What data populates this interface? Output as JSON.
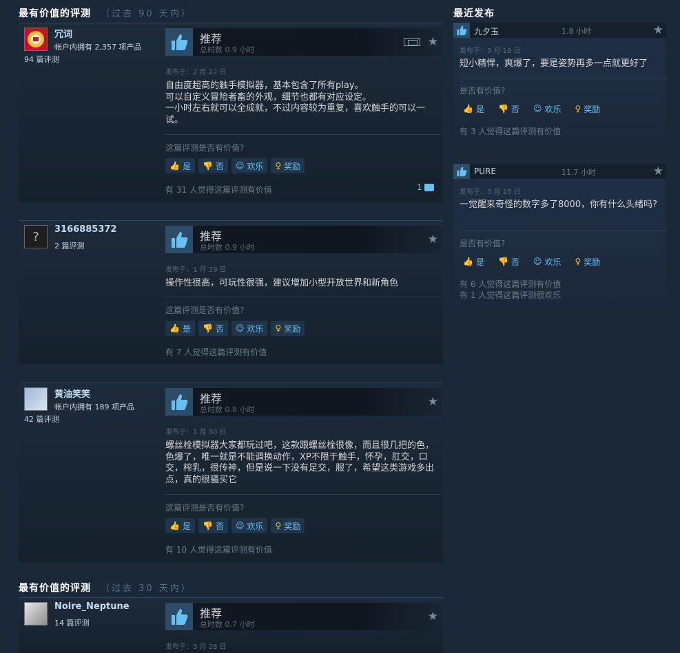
{
  "sections": {
    "most_helpful_90": {
      "title": "最有价值的评测",
      "period": "（过去 90 天内）"
    },
    "recent": {
      "title": "最近发布"
    },
    "most_helpful_30": {
      "title": "最有价值的评测",
      "period": "（过去 30 天内）"
    }
  },
  "labels": {
    "recommended": "推荐",
    "helpful_question": "这篇评测是否有价值?",
    "helpful_question_short": "是否有价值?",
    "yes": "是",
    "no": "否",
    "funny": "欢乐",
    "award": "奖励"
  },
  "reviews": [
    {
      "user": "冗词",
      "products": "帐户内拥有 2,357 项产品",
      "review_count": "94 篇评测",
      "hours": "总时数 0.9 小时",
      "posted": "发布于：2 月 22 日",
      "content": "自由度超高的触手模拟器，基本包含了所有play。\n可以自定义冒险者畜的外观，细节也都有对应设定。\n一小时左右就可以全成就，不过内容较为重复，喜欢触手的可以一试。",
      "helpful": "有 31 人觉得这篇评测有价值",
      "comments": "1"
    },
    {
      "user": "3166885372",
      "products": "",
      "review_count": "2 篇评测",
      "hours": "总时数 0.9 小时",
      "posted": "发布于：1 月 29 日",
      "content": "操作性很高，可玩性很强，建议增加小型开放世界和新角色",
      "helpful": "有 7 人觉得这篇评测有价值"
    },
    {
      "user": "黄油笑笑",
      "products": "帐户内拥有 189 项产品",
      "review_count": "42 篇评测",
      "hours": "总时数 0.8 小时",
      "posted": "发布于：1 月 30 日",
      "content": "螺丝栓模拟器大家都玩过吧，这款跟螺丝栓很像，而且很几把的色，色爆了，唯一就是不能调换动作，XP不限于触手，怀孕，肛交，口交，榨乳，很传神，但是说一下没有足交，服了，希望这类游戏多出点，真的很骚买它",
      "helpful": "有 10 人觉得这篇评测有价值"
    },
    {
      "user": "Noire_Neptune",
      "products": "",
      "review_count": "14 篇评测",
      "hours": "总时数 0.7 小时",
      "posted": "发布于：3 月 28 日"
    }
  ],
  "recent": [
    {
      "user": "九夕玉",
      "hours": "1.8 小时",
      "posted": "发布于：3 月 19 日",
      "content": "短小精悍，爽爆了，要是姿势再多一点就更好了",
      "helpful": "有 3 人觉得这篇评测有价值",
      "funny": ""
    },
    {
      "user": "PURE",
      "hours": "11.7 小时",
      "posted": "发布于：3 月 15 日",
      "content": "一觉醒来奇怪的数字多了8000，你有什么头绪吗?",
      "helpful": "有 6 人觉得这篇评测有价值",
      "funny": "有 1 人觉得这篇评测很欢乐"
    }
  ],
  "icons": {
    "thumb_up": "thumbs-up-icon",
    "thumb_down": "thumbs-down-icon",
    "funny": "smiley-icon",
    "award": "award-icon",
    "star": "star-icon",
    "deck": "steam-deck-icon",
    "comment": "comment-icon"
  },
  "colors": {
    "background": "#1b2838",
    "accent": "#66c0f4",
    "thumb_box": "#2c4b66"
  }
}
